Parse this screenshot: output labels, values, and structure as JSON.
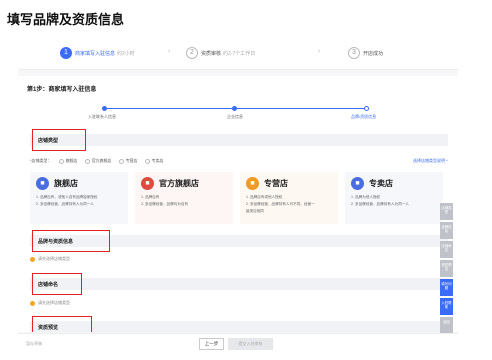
{
  "page_title": "填写品牌及资质信息",
  "steps": [
    {
      "num": "1",
      "label": "商家填写入驻信息",
      "sub": "约2小时"
    },
    {
      "num": "2",
      "label": "资质审核",
      "sub": "约2-7个工作日"
    },
    {
      "num": "3",
      "label": "开店成功",
      "sub": ""
    }
  ],
  "form_title": "第1步：商家填写入驻信息",
  "progress": [
    {
      "label": "入驻联系人信息"
    },
    {
      "label": "企业信息"
    },
    {
      "label": "品牌/资质信息"
    }
  ],
  "sections": {
    "store_type": "店铺类型",
    "brand": "品牌与资质信息",
    "store_name": "店铺命名",
    "qualification": "资质预览"
  },
  "store_type_row": {
    "label": "*店铺类型：",
    "options": [
      "旗舰店",
      "官方旗舰店",
      "专营店",
      "专卖店"
    ],
    "link": "选择店铺类型说明 ^"
  },
  "cards": [
    {
      "name": "旗舰店",
      "icon": "store-icon",
      "color": "#4a6ee0",
      "lines": [
        "1. 品牌自有，或他人自有品牌独家授权",
        "2. 多品牌经营，品牌持有人为同一人"
      ]
    },
    {
      "name": "官方旗舰店",
      "icon": "store-icon",
      "color": "#e04a3f",
      "lines": [
        "1. 品牌自有",
        "2. 多品牌经营，品牌均为自有"
      ]
    },
    {
      "name": "专营店",
      "icon": "store-icon",
      "color": "#f09a2b",
      "lines": [
        "1. 品牌自有或他人授权",
        "2. 多品牌经营，品牌持有人可不同，经营一",
        "   级类目相同"
      ]
    },
    {
      "name": "专卖店",
      "icon": "store-icon",
      "color": "#4a6ee0",
      "lines": [
        "1. 品牌为他人授权",
        "2. 多品牌经营，品牌持有人为同一人"
      ]
    }
  ],
  "hints": {
    "brand": "请先选择店铺类型",
    "store_name": "请先选择店铺类型"
  },
  "side_nav": [
    "店铺类型",
    "品牌信息",
    "店铺命名",
    "资质预览",
    "填写问题",
    "入驻帮助",
    "返回"
  ],
  "side_nav_active": 4,
  "bottom": {
    "note": "暂存草稿",
    "prev": "上一步",
    "next": "提交入驻审核"
  }
}
